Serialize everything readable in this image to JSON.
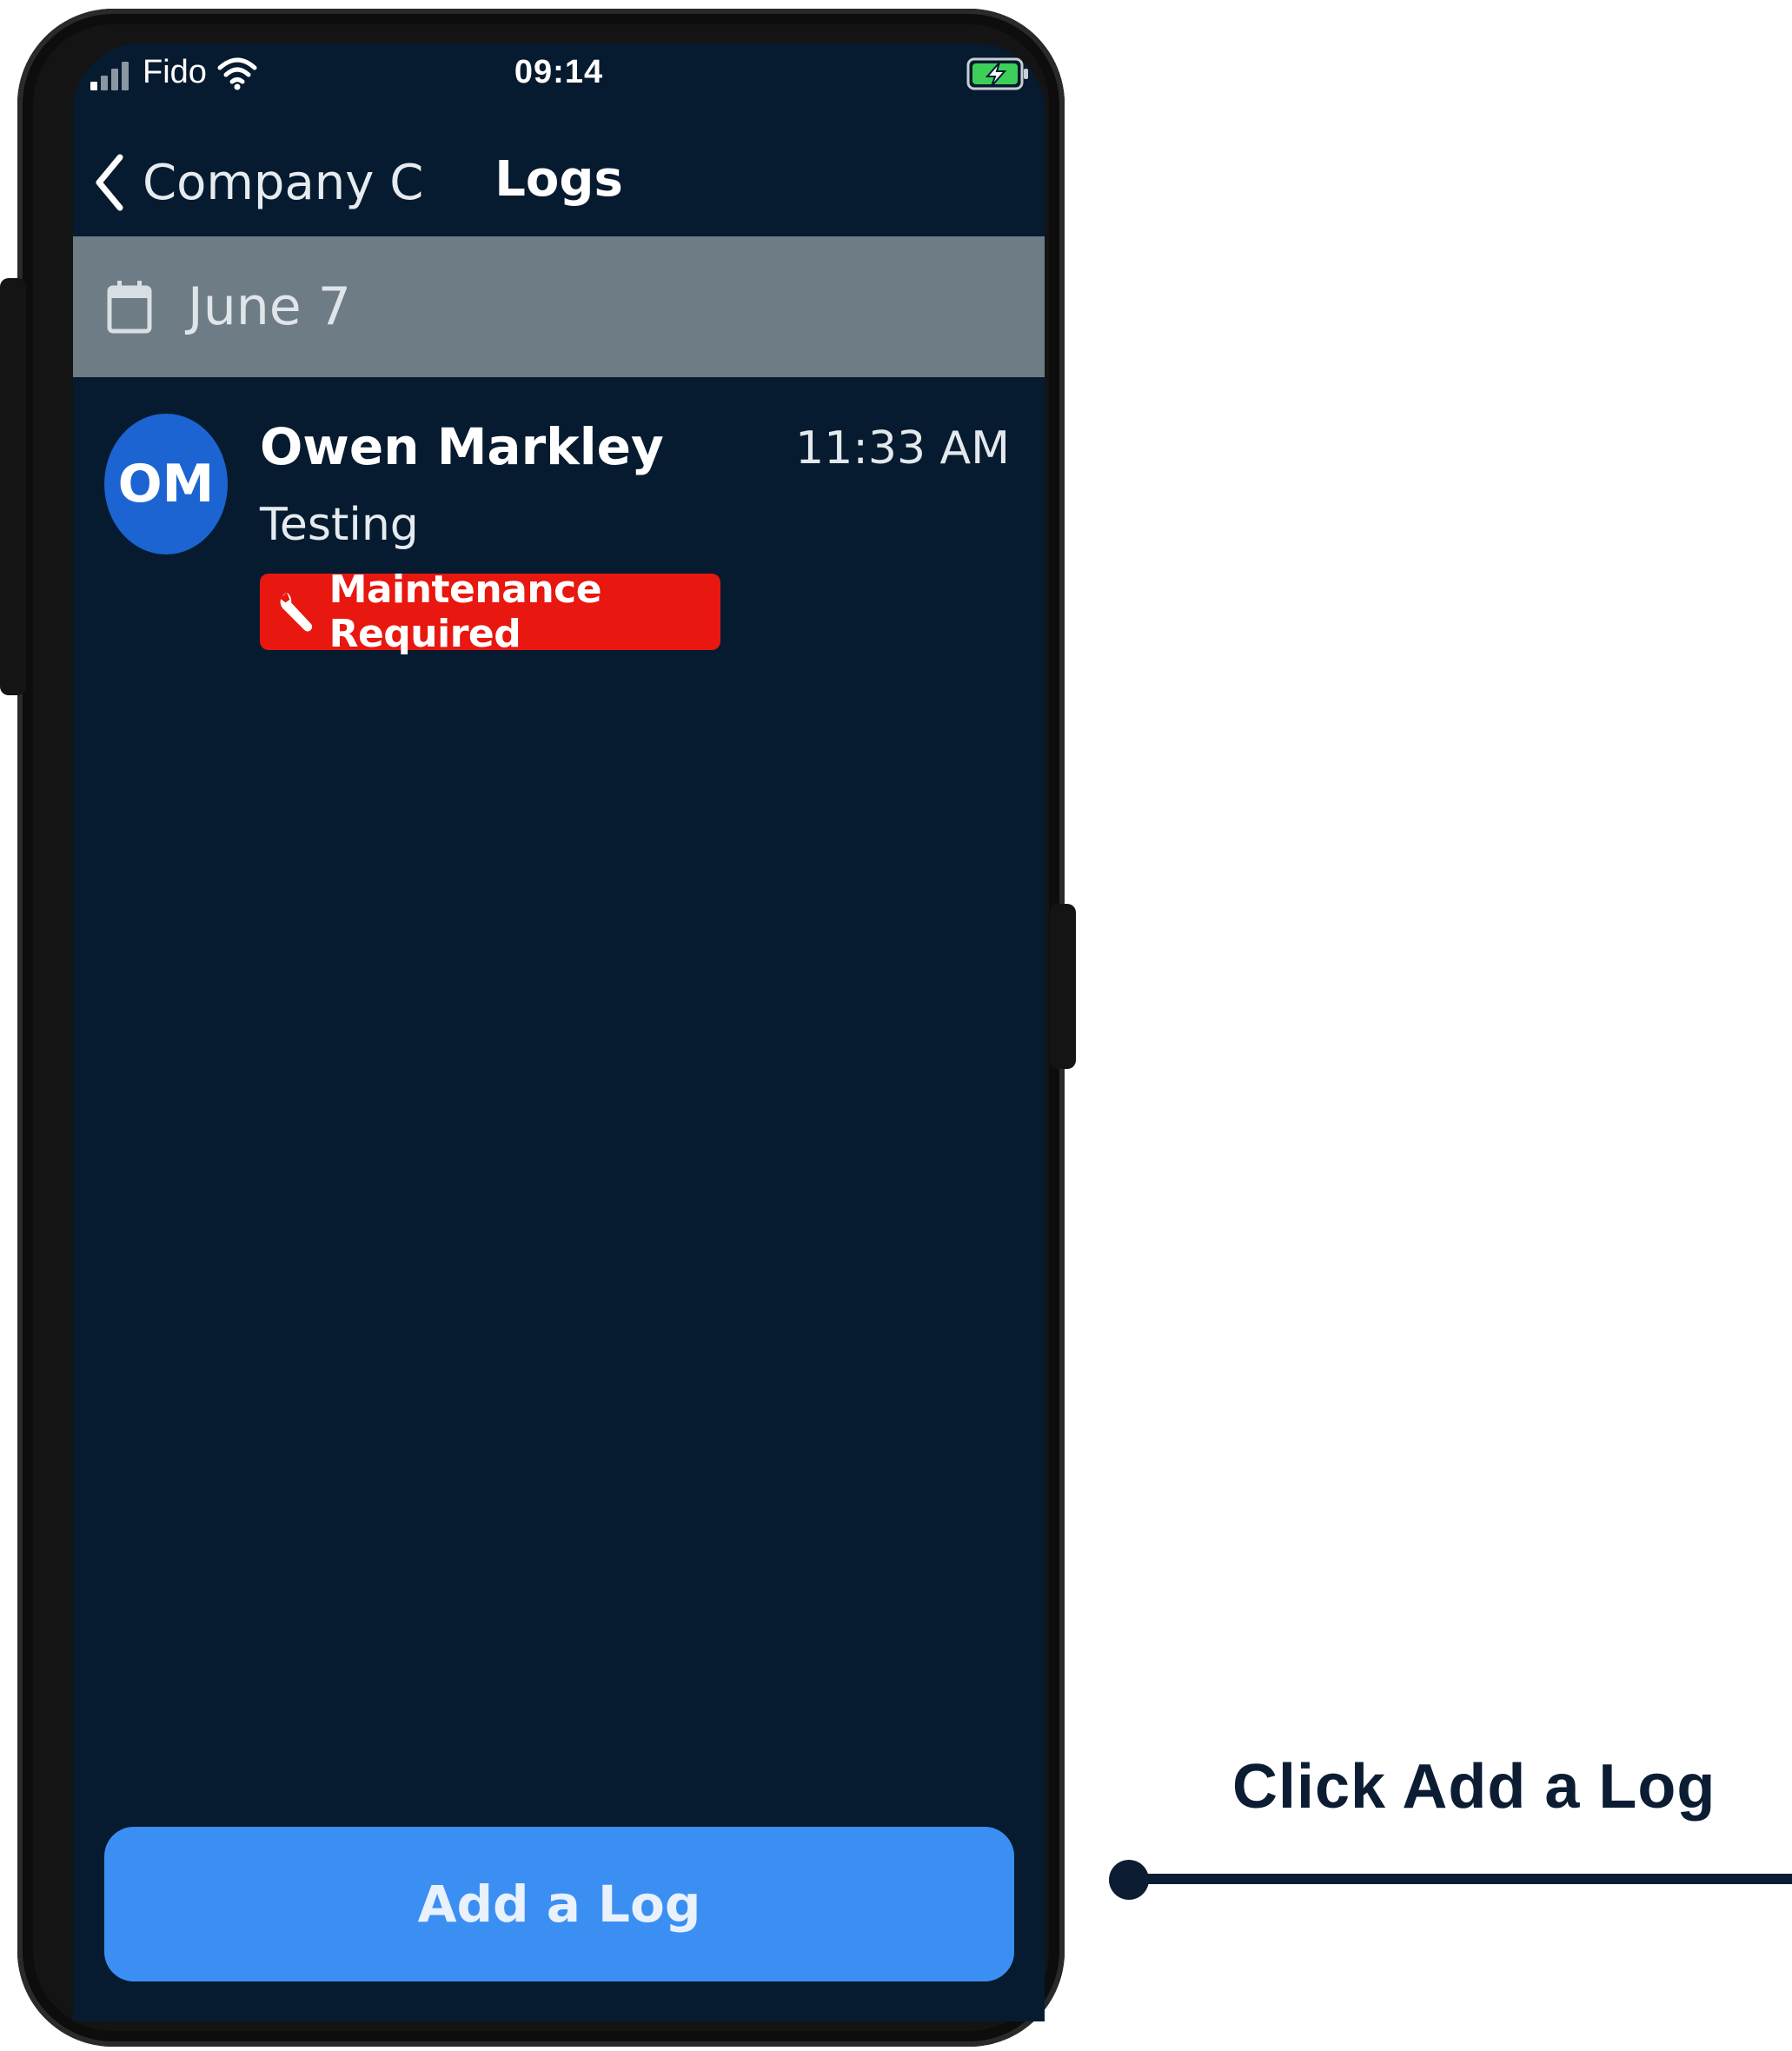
{
  "status_bar": {
    "carrier": "Fido",
    "time": "09:14",
    "signal_bars_active": 1,
    "battery_state": "charging"
  },
  "nav": {
    "back_label": "Company C",
    "title": "Logs"
  },
  "date_section": {
    "label": "June 7"
  },
  "log_entry": {
    "avatar_initials": "OM",
    "author": "Owen Markley",
    "time": "11:33 AM",
    "text": "Testing",
    "badge": {
      "label": "Maintenance Required",
      "icon": "wrench-icon",
      "color": "#e8170f"
    }
  },
  "add_log_button": {
    "label": "Add a Log",
    "color": "#3b8ff2"
  },
  "callout": {
    "text": "Click Add a Log"
  },
  "colors": {
    "screen_bg": "#061b2f",
    "date_header_bg": "#6e7c85",
    "avatar_bg": "#1c64d1",
    "callout": "#0c1d33"
  }
}
